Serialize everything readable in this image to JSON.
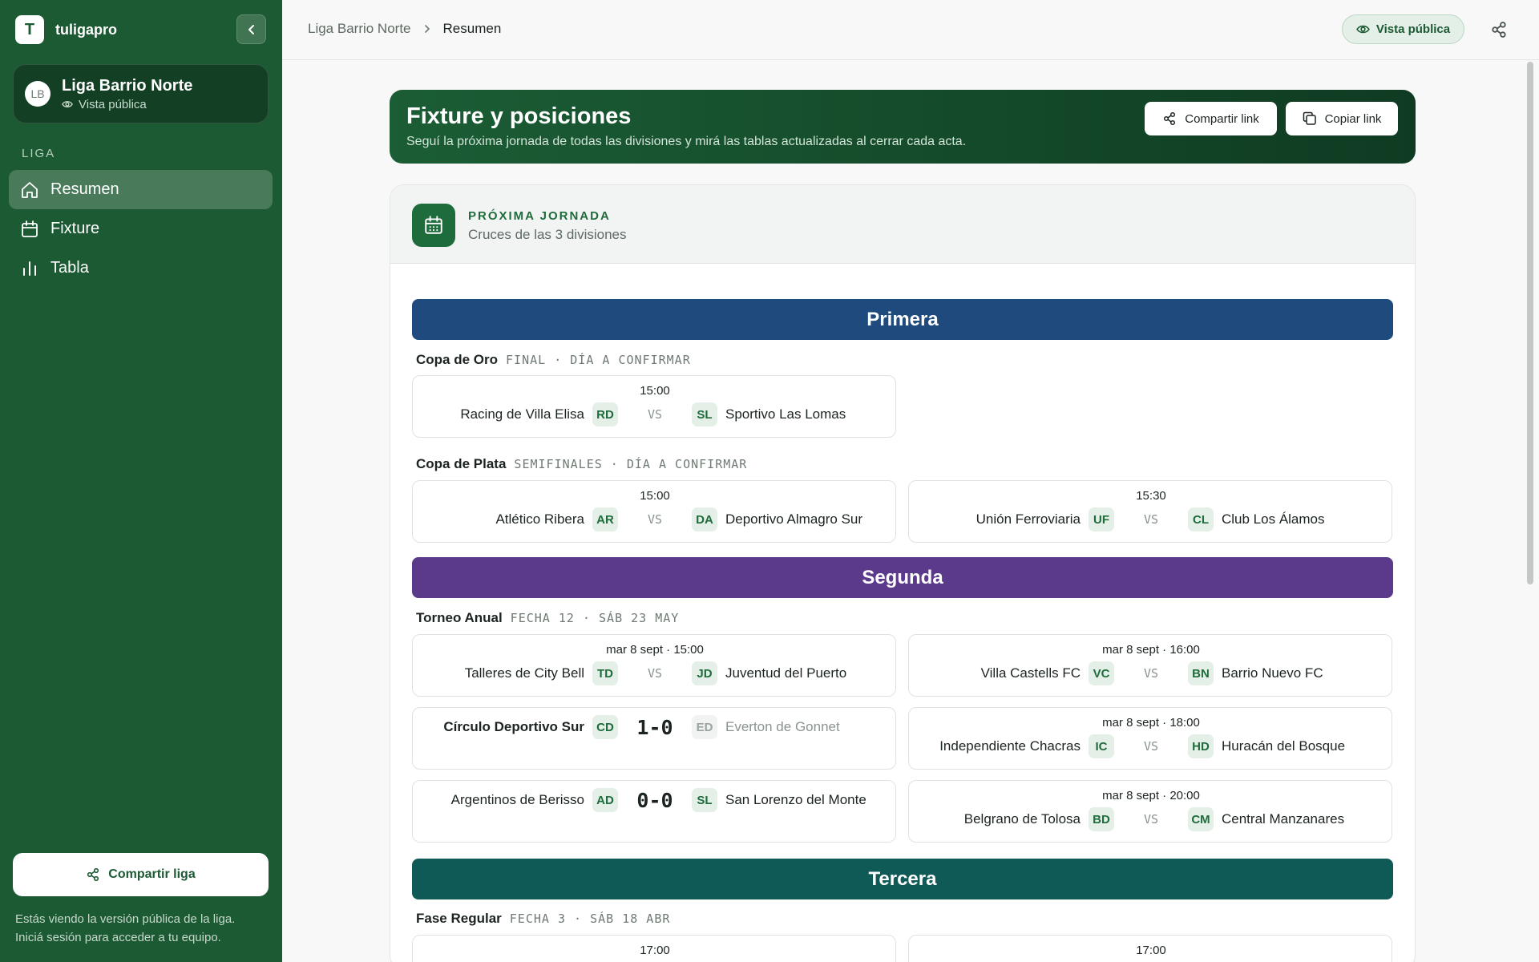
{
  "sidebar": {
    "brand_mark": "T",
    "brand": "tuligapro",
    "league": {
      "initials": "LB",
      "name": "Liga Barrio Norte",
      "sub": "Vista pública"
    },
    "section": "LIGA",
    "nav": [
      {
        "label": "Resumen",
        "icon": "home-icon",
        "active": true
      },
      {
        "label": "Fixture",
        "icon": "calendar-icon",
        "active": false
      },
      {
        "label": "Tabla",
        "icon": "bar-chart-icon",
        "active": false
      }
    ],
    "share_label": "Compartir liga",
    "note_1": "Estás viendo la versión pública de la liga.",
    "note_2": "Iniciá sesión para acceder a tu equipo."
  },
  "topbar": {
    "breadcrumb": [
      "Liga Barrio Norte",
      "Resumen"
    ],
    "public_view": "Vista pública"
  },
  "hero": {
    "title": "Fixture y posiciones",
    "subtitle": "Seguí la próxima jornada de todas las divisiones y mirá las tablas actualizadas al cerrar cada acta.",
    "share_link": "Compartir link",
    "copy_link": "Copiar link"
  },
  "card": {
    "kicker": "PRÓXIMA JORNADA",
    "subtitle": "Cruces de las 3 divisiones"
  },
  "colors": {
    "primera": "#1e4a7d",
    "segunda": "#5b3a8c",
    "tercera": "#0f5a57",
    "brand": "#1c5a33"
  },
  "divisions": [
    {
      "name": "Primera",
      "groups": [
        {
          "name": "Copa de Oro",
          "tag": "FINAL · DÍA A CONFIRMAR",
          "matches": [
            {
              "time": "15:00",
              "home": "Racing de Villa Elisa",
              "home_code": "RD",
              "away": "Sportivo Las Lomas",
              "away_code": "SL",
              "center": "VS"
            }
          ]
        },
        {
          "name": "Copa de Plata",
          "tag": "SEMIFINALES · DÍA A CONFIRMAR",
          "matches": [
            {
              "time": "15:00",
              "home": "Atlético Ribera",
              "home_code": "AR",
              "away": "Deportivo Almagro Sur",
              "away_code": "DA",
              "center": "VS"
            },
            {
              "time": "15:30",
              "home": "Unión Ferroviaria",
              "home_code": "UF",
              "away": "Club Los Álamos",
              "away_code": "CL",
              "center": "VS"
            }
          ]
        }
      ]
    },
    {
      "name": "Segunda",
      "groups": [
        {
          "name": "Torneo Anual",
          "tag": "FECHA 12 · SÁB 23 MAY",
          "matches": [
            {
              "time": "mar 8 sept · 15:00",
              "home": "Talleres de City Bell",
              "home_code": "TD",
              "away": "Juventud del Puerto",
              "away_code": "JD",
              "center": "VS"
            },
            {
              "time": "mar 8 sept · 16:00",
              "home": "Villa Castells FC",
              "home_code": "VC",
              "away": "Barrio Nuevo FC",
              "away_code": "BN",
              "center": "VS"
            },
            {
              "time": "",
              "home": "Círculo Deportivo Sur",
              "home_code": "CD",
              "away": "Everton de Gonnet",
              "away_code": "ED",
              "center": "1-0"
            },
            {
              "time": "mar 8 sept · 18:00",
              "home": "Independiente Chacras",
              "home_code": "IC",
              "away": "Huracán del Bosque",
              "away_code": "HD",
              "center": "VS"
            },
            {
              "time": "",
              "home": "Argentinos de Berisso",
              "home_code": "AD",
              "away": "San Lorenzo del Monte",
              "away_code": "SL",
              "center": "0-0"
            },
            {
              "time": "mar 8 sept · 20:00",
              "home": "Belgrano de Tolosa",
              "home_code": "BD",
              "away": "Central Manzanares",
              "away_code": "CM",
              "center": "VS"
            }
          ]
        }
      ]
    },
    {
      "name": "Tercera",
      "groups": [
        {
          "name": "Fase Regular",
          "tag": "FECHA 3 · SÁB 18 ABR",
          "matches": [
            {
              "time": "17:00"
            },
            {
              "time": "17:00"
            }
          ]
        }
      ]
    }
  ]
}
